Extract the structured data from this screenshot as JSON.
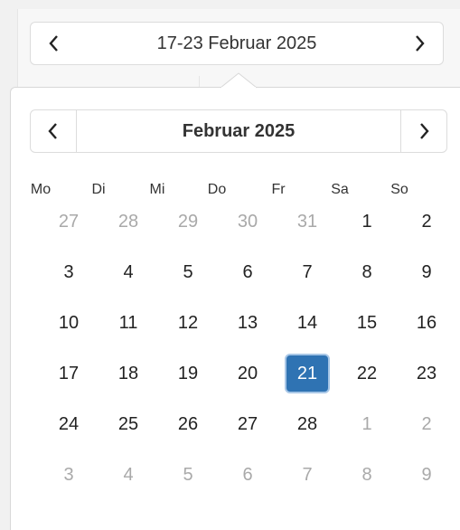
{
  "week_nav": {
    "label": "17-23 Februar 2025",
    "prev_icon": "chevron-left-icon",
    "next_icon": "chevron-right-icon"
  },
  "calendar": {
    "month_label": "Februar 2025",
    "prev_icon": "chevron-left-icon",
    "next_icon": "chevron-right-icon",
    "weekdays": [
      "Mo",
      "Di",
      "Mi",
      "Do",
      "Fr",
      "Sa",
      "So"
    ],
    "weeks": [
      [
        {
          "d": "27",
          "m": true
        },
        {
          "d": "28",
          "m": true
        },
        {
          "d": "29",
          "m": true
        },
        {
          "d": "30",
          "m": true
        },
        {
          "d": "31",
          "m": true
        },
        {
          "d": "1"
        },
        {
          "d": "2"
        }
      ],
      [
        {
          "d": "3"
        },
        {
          "d": "4"
        },
        {
          "d": "5"
        },
        {
          "d": "6"
        },
        {
          "d": "7"
        },
        {
          "d": "8"
        },
        {
          "d": "9"
        }
      ],
      [
        {
          "d": "10"
        },
        {
          "d": "11"
        },
        {
          "d": "12"
        },
        {
          "d": "13"
        },
        {
          "d": "14"
        },
        {
          "d": "15"
        },
        {
          "d": "16"
        }
      ],
      [
        {
          "d": "17"
        },
        {
          "d": "18"
        },
        {
          "d": "19"
        },
        {
          "d": "20"
        },
        {
          "d": "21",
          "sel": true
        },
        {
          "d": "22"
        },
        {
          "d": "23"
        }
      ],
      [
        {
          "d": "24"
        },
        {
          "d": "25"
        },
        {
          "d": "26"
        },
        {
          "d": "27"
        },
        {
          "d": "28"
        },
        {
          "d": "1",
          "m": true
        },
        {
          "d": "2",
          "m": true
        }
      ],
      [
        {
          "d": "3",
          "m": true
        },
        {
          "d": "4",
          "m": true
        },
        {
          "d": "5",
          "m": true
        },
        {
          "d": "6",
          "m": true
        },
        {
          "d": "7",
          "m": true
        },
        {
          "d": "8",
          "m": true
        },
        {
          "d": "9",
          "m": true
        }
      ]
    ]
  },
  "colors": {
    "selected_bg": "#2f73b3",
    "muted_text": "#a9a9a9"
  }
}
